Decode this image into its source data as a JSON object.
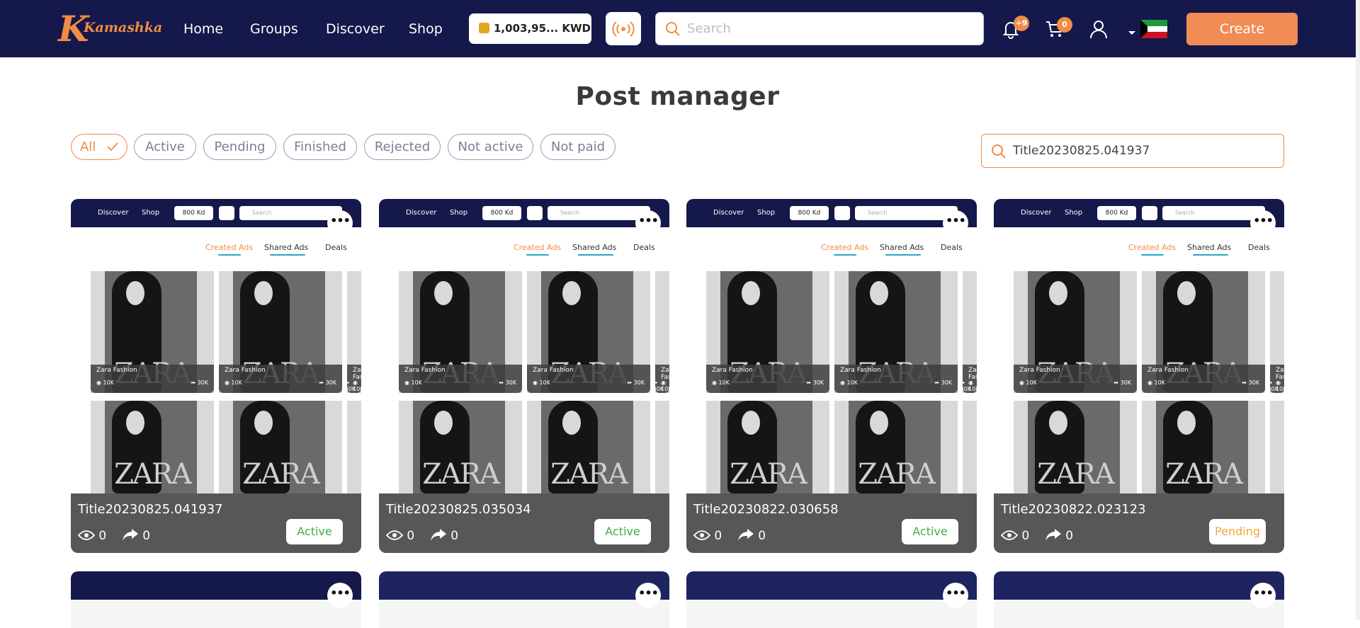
{
  "header": {
    "logo_text": "Kamashka",
    "nav": [
      "Home",
      "Groups",
      "Discover",
      "Shop"
    ],
    "wallet": "1,003,95... KWD",
    "search_placeholder": "Search",
    "notifications_badge": "+9",
    "cart_badge": "0",
    "create_label": "Create"
  },
  "page": {
    "title": "Post manager",
    "filters": [
      {
        "label": "All",
        "active": true
      },
      {
        "label": "Active"
      },
      {
        "label": "Pending"
      },
      {
        "label": "Finished"
      },
      {
        "label": "Rejected"
      },
      {
        "label": "Not active"
      },
      {
        "label": "Not paid"
      }
    ],
    "search_value": "Title20230825.041937"
  },
  "preview": {
    "nav": [
      "Discover",
      "Shop"
    ],
    "wallet": "800 Kd",
    "search": "Search",
    "tabs": [
      "Created Ads",
      "Shared Ads",
      "Deals"
    ],
    "item_name": "Zara Fashion",
    "views": "10K",
    "shares": "30K",
    "brand": "ZARA"
  },
  "cards": [
    {
      "title": "Title20230825.041937",
      "views": "0",
      "shares": "0",
      "status": "Active",
      "status_color": "#3fae3f"
    },
    {
      "title": "Title20230825.035034",
      "views": "0",
      "shares": "0",
      "status": "Active",
      "status_color": "#3fae3f"
    },
    {
      "title": "Title20230822.030658",
      "views": "0",
      "shares": "0",
      "status": "Active",
      "status_color": "#3fae3f"
    },
    {
      "title": "Title20230822.023123",
      "views": "0",
      "shares": "0",
      "status": "Pending",
      "status_color": "#f5a43a"
    }
  ],
  "colors": {
    "brand_orange": "#f08c47",
    "navy": "#15184a"
  }
}
